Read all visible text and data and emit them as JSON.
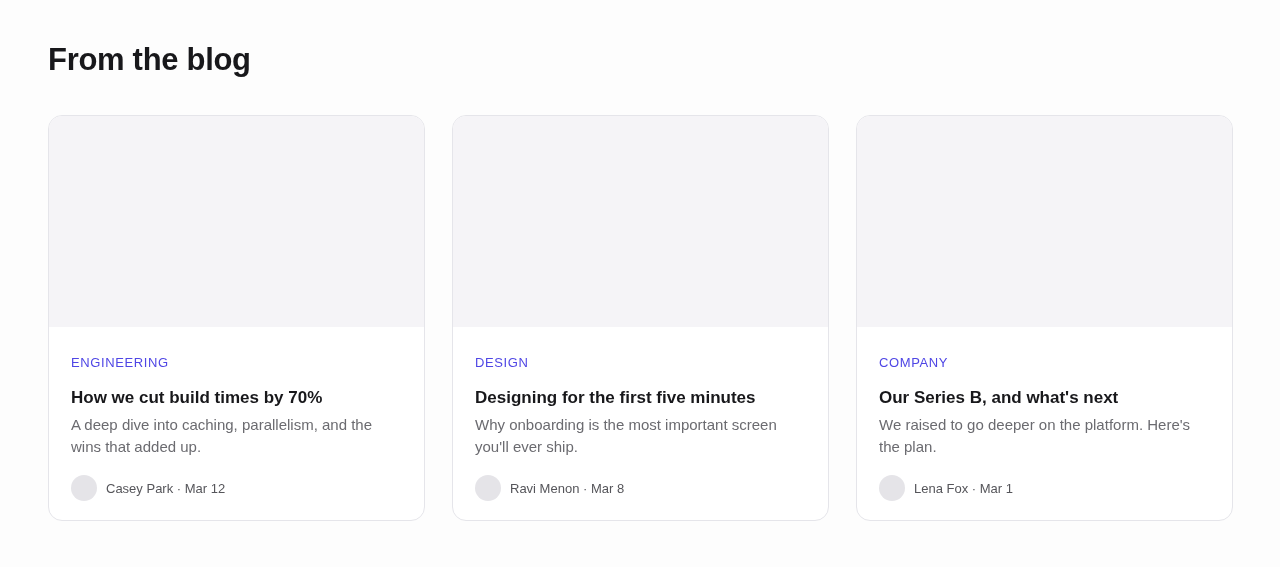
{
  "heading": "From the blog",
  "posts": [
    {
      "category": "ENGINEERING",
      "title": "How we cut build times by 70%",
      "excerpt": "A deep dive into caching, parallelism, and the wins that added up.",
      "byline": "Casey Park · Mar 12"
    },
    {
      "category": "DESIGN",
      "title": "Designing for the first five minutes",
      "excerpt": "Why onboarding is the most important screen you'll ever ship.",
      "byline": "Ravi Menon · Mar 8"
    },
    {
      "category": "COMPANY",
      "title": "Our Series B, and what's next",
      "excerpt": "We raised to go deeper on the platform. Here's the plan.",
      "byline": "Lena Fox · Mar 1"
    }
  ]
}
